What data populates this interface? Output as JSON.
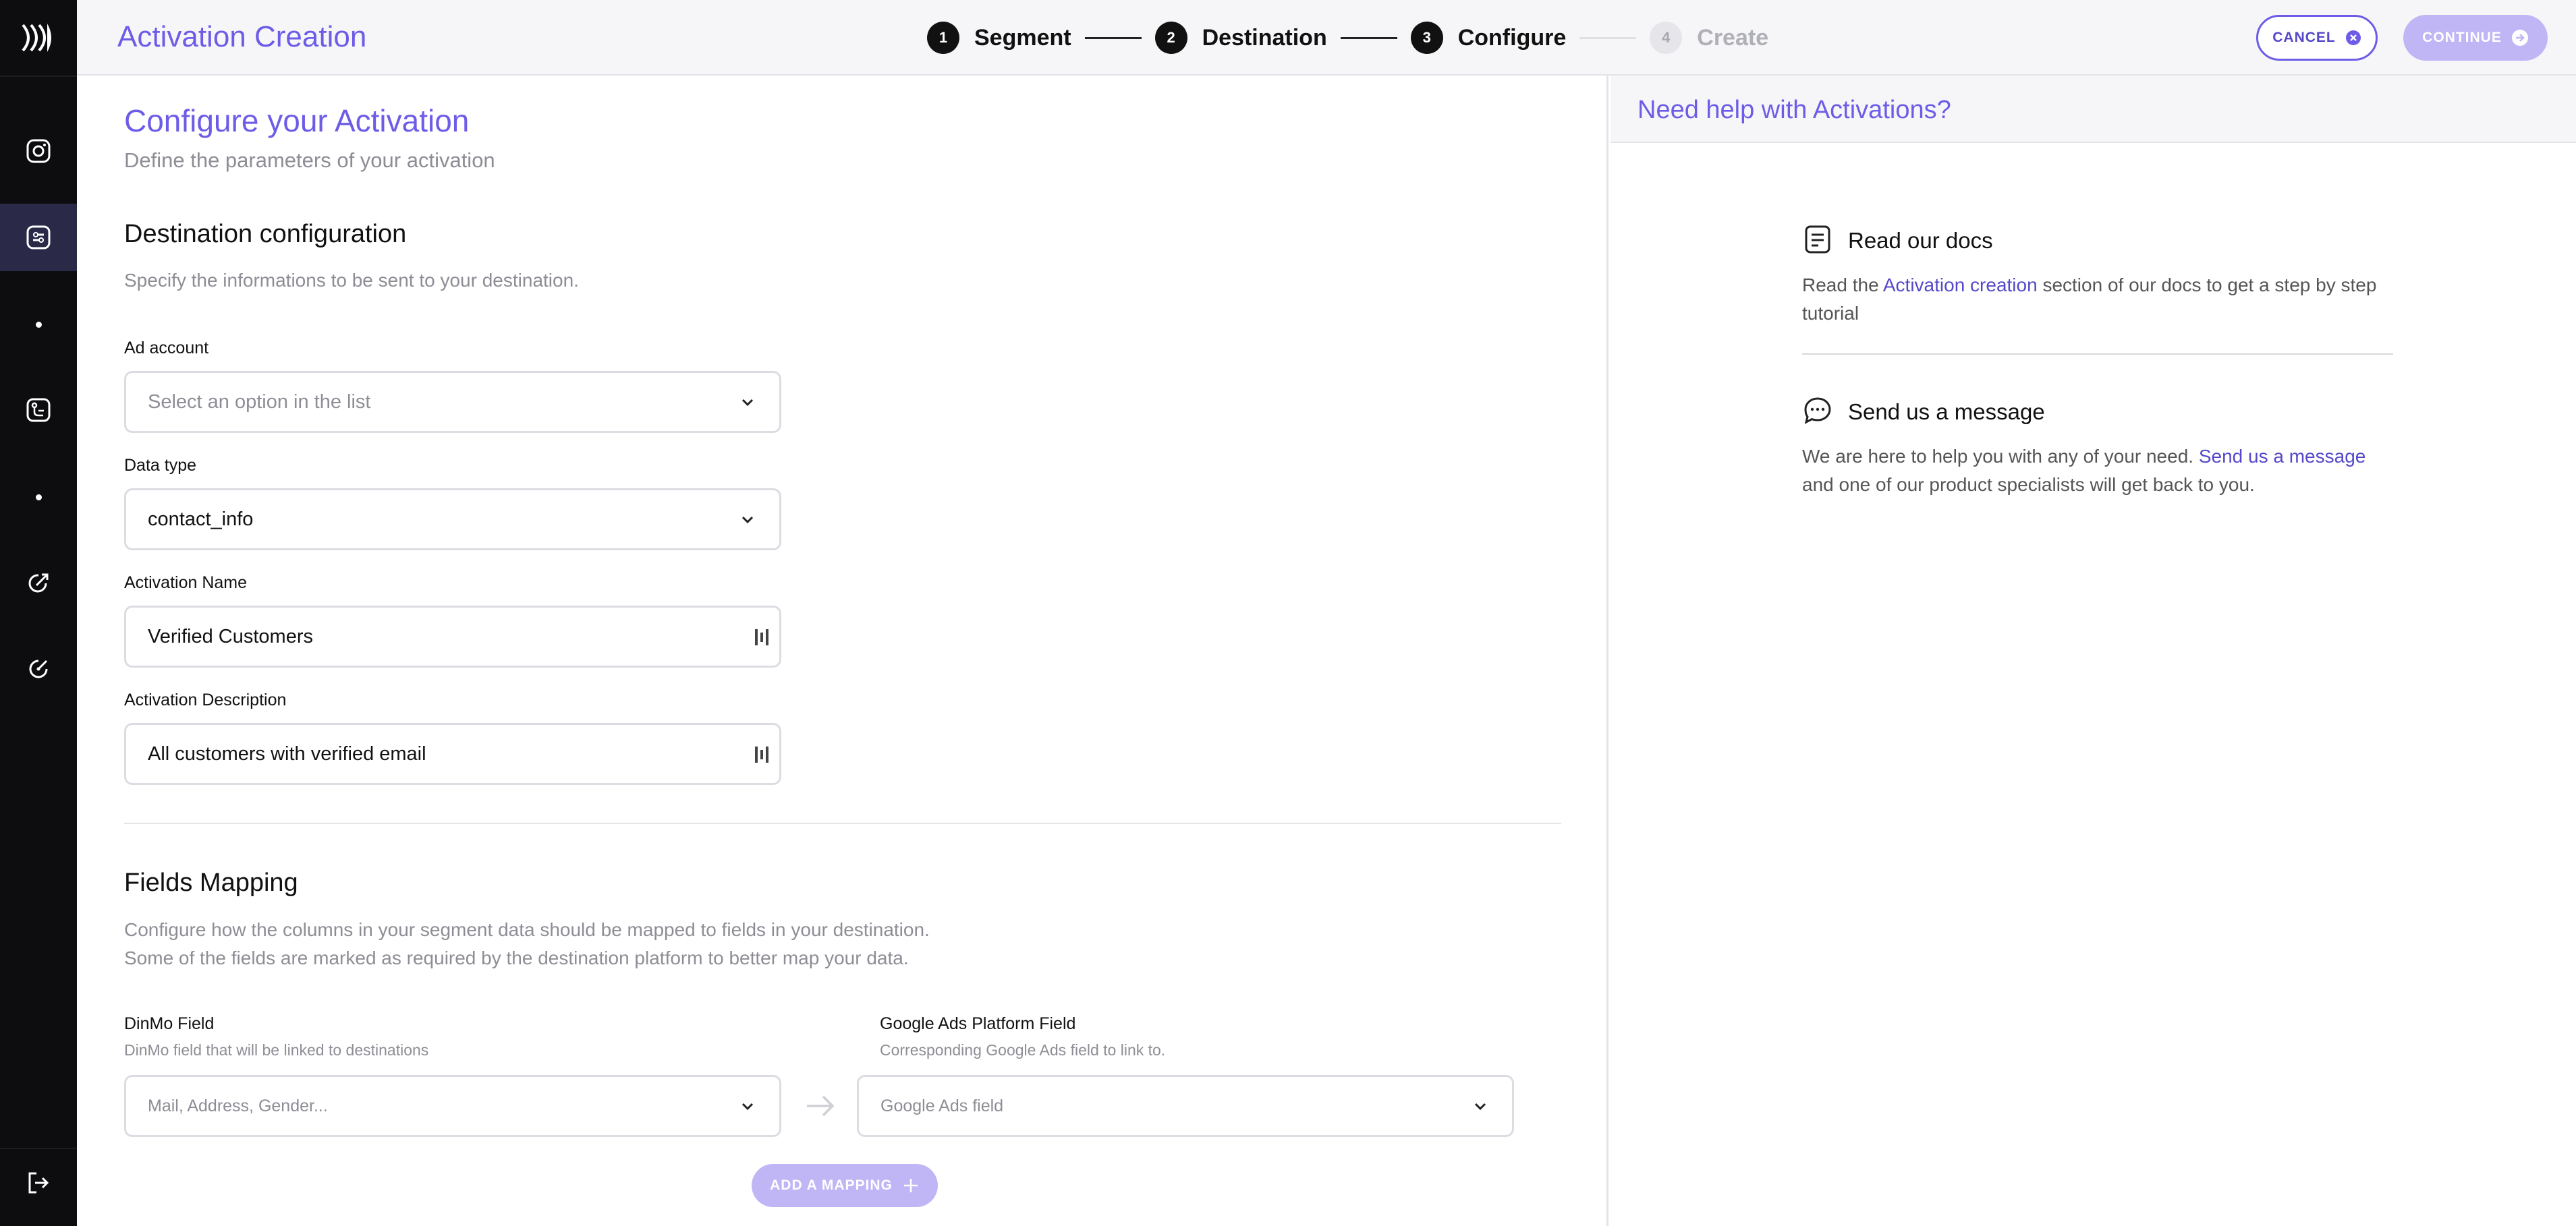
{
  "header": {
    "title": "Activation Creation",
    "steps": [
      {
        "num": "1",
        "label": "Segment"
      },
      {
        "num": "2",
        "label": "Destination"
      },
      {
        "num": "3",
        "label": "Configure"
      },
      {
        "num": "4",
        "label": "Create"
      }
    ],
    "current_step": 3,
    "cancel_label": "CANCEL",
    "continue_label": "CONTINUE"
  },
  "sidebar": {
    "icons": [
      "logo-icon",
      "instagram-icon",
      "segments-icon",
      "destinations-icon",
      "activations-icon",
      "analytics-icon",
      "logout-icon"
    ]
  },
  "main": {
    "title": "Configure your Activation",
    "subtitle": "Define the parameters of your activation",
    "destination": {
      "title": "Destination configuration",
      "subtitle": "Specify the informations to be sent to your destination.",
      "ad_account": {
        "label": "Ad account",
        "placeholder": "Select an option in the list"
      },
      "data_type": {
        "label": "Data type",
        "value": "contact_info"
      },
      "activation_name": {
        "label": "Activation Name",
        "value": "Verified Customers"
      },
      "activation_description": {
        "label": "Activation Description",
        "value": "All customers with verified email"
      }
    },
    "mapping": {
      "title": "Fields Mapping",
      "subtitle_line1": "Configure how the columns in your segment data should be mapped to fields in your destination.",
      "subtitle_line2": "Some of the fields are marked as required by the destination platform to better map your data.",
      "dinmo_label": "DinMo Field",
      "dinmo_help": "DinMo field that will be linked to destinations",
      "dinmo_placeholder": "Mail, Address, Gender...",
      "platform_label": "Google Ads Platform Field",
      "platform_help": "Corresponding Google Ads field to link to.",
      "platform_placeholder": "Google Ads field",
      "add_label": "ADD A MAPPING"
    }
  },
  "help": {
    "title": "Need help with Activations?",
    "docs": {
      "title": "Read our docs",
      "text_before": "Read the ",
      "link": "Activation creation",
      "text_after": " section of our docs to get a step by step tutorial"
    },
    "message": {
      "title": "Send us a message",
      "text_before": "We are here to help you with any of your need. ",
      "link": "Send us a message",
      "text_after": " and one of our product specialists will get back to you."
    }
  },
  "colors": {
    "accent": "#6c5ce7",
    "accent_light": "#c0b6f5",
    "sidebar_bg": "#0d0d0f",
    "sidebar_active": "#2a2948"
  }
}
